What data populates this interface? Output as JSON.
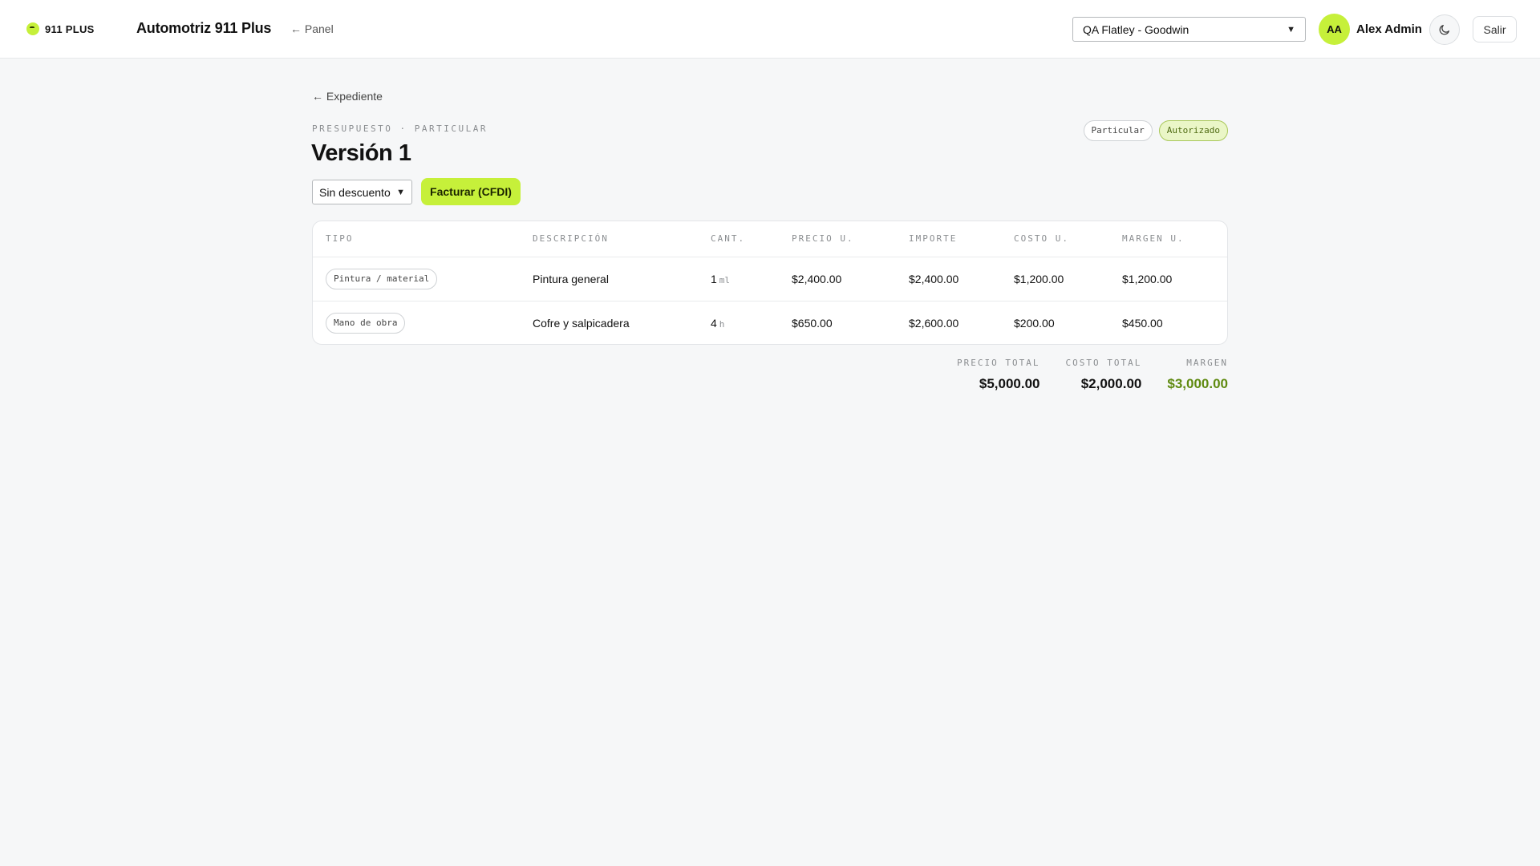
{
  "header": {
    "logo_text": "911 PLUS",
    "app_title": "Automotriz 911 Plus",
    "back_panel": "← Panel",
    "shop_selected": "QA Flatley - Goodwin",
    "avatar_initials": "AA",
    "user_name": "Alex Admin",
    "theme_icon": "moon-icon",
    "logout_label": "Salir"
  },
  "page": {
    "back_link": "← Expediente",
    "eyebrow": "PRESUPUESTO · PARTICULAR",
    "title": "Versión 1",
    "badges": [
      "Particular",
      "Autorizado"
    ],
    "discount_selected": "Sin descuento",
    "invoice_label": "Facturar (CFDI)"
  },
  "table": {
    "columns": [
      "TIPO",
      "DESCRIPCIÓN",
      "CANT.",
      "PRECIO U.",
      "IMPORTE",
      "COSTO U.",
      "MARGEN U."
    ],
    "rows": [
      {
        "type": "Pintura / material",
        "description": "Pintura general",
        "qty": "1",
        "unit": "ml",
        "unit_price": "$2,400.00",
        "amount": "$2,400.00",
        "unit_cost": "$1,200.00",
        "unit_margin": "$1,200.00"
      },
      {
        "type": "Mano de obra",
        "description": "Cofre y salpicadera",
        "qty": "4",
        "unit": "h",
        "unit_price": "$650.00",
        "amount": "$2,600.00",
        "unit_cost": "$200.00",
        "unit_margin": "$450.00"
      }
    ]
  },
  "totals": {
    "price_label": "PRECIO TOTAL",
    "price_value": "$5,000.00",
    "cost_label": "COSTO TOTAL",
    "cost_value": "$2,000.00",
    "margin_label": "MARGEN",
    "margin_value": "$3,000.00"
  },
  "colors": {
    "accent": "#c6f03a",
    "margin_text": "#5f8a10",
    "background": "#f6f7f8"
  }
}
